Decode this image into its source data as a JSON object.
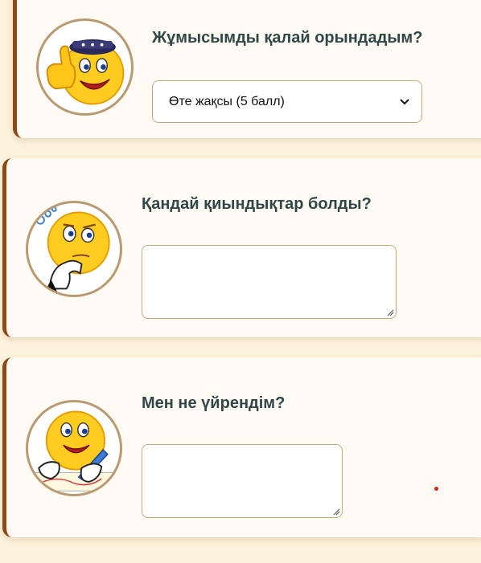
{
  "cards": [
    {
      "question": "Жұмысымды қалай орындадым?",
      "avatar_icon": "thumbs-up-smiley-icon",
      "select": {
        "selected": "Өте жақсы (5 балл)"
      }
    },
    {
      "question": "Қандай қиындықтар болды?",
      "avatar_icon": "thinking-smiley-icon",
      "textarea": {
        "value": ""
      }
    },
    {
      "question": "Мен не үйрендім?",
      "avatar_icon": "writing-smiley-icon",
      "textarea": {
        "value": ""
      }
    }
  ],
  "colors": {
    "page_bg": "#fdf3dc",
    "card_bg": "#fffbf4",
    "accent_border": "#8b4a17",
    "question_text": "#2f4747",
    "field_border": "#c3a77d"
  }
}
